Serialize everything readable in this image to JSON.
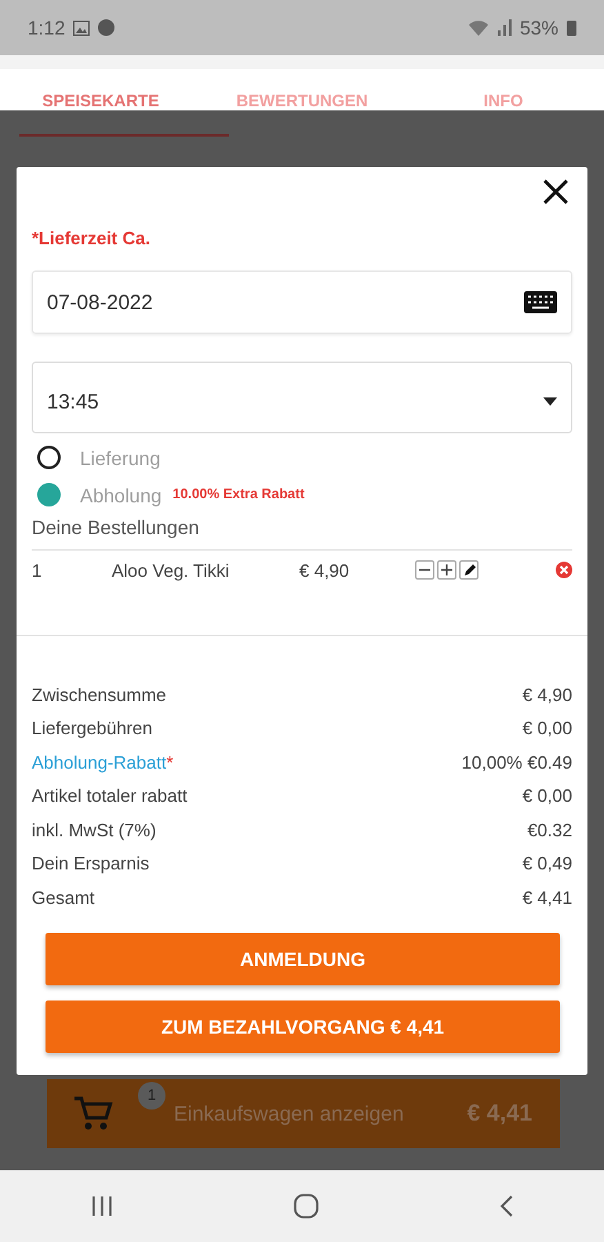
{
  "status_bar": {
    "time": "1:12",
    "battery": "53%"
  },
  "tabs": [
    {
      "label": "SPEISEKARTE",
      "selected": true
    },
    {
      "label": "BEWERTUNGEN",
      "selected": false
    },
    {
      "label": "INFO",
      "selected": false
    }
  ],
  "modal": {
    "title": "*Lieferzeit Ca.",
    "date_field": {
      "value": "07-08-2022"
    },
    "time_select": {
      "value": "13:45"
    },
    "options": [
      {
        "label": "Lieferung",
        "selected": false
      },
      {
        "label": "Abholung",
        "selected": true,
        "note": "10.00% Extra Rabatt"
      }
    ],
    "orders_heading": "Deine Bestellungen",
    "orders": [
      {
        "qty": "1",
        "name": "Aloo Veg. Tikki",
        "price": "€ 4,90"
      }
    ],
    "summary": [
      {
        "label": "Zwischensumme",
        "value": "€ 4,90",
        "kind": "plain"
      },
      {
        "label": "Liefergebühren",
        "value": "€ 0,00",
        "kind": "plain"
      },
      {
        "label": "Abholung-Rabatt",
        "marker": "*",
        "value": "10,00% €0.49",
        "kind": "link"
      },
      {
        "label": "Artikel totaler rabatt",
        "value": "€ 0,00",
        "kind": "plain"
      },
      {
        "label": "inkl. MwSt (7%)",
        "value": "€0.32",
        "kind": "plain"
      },
      {
        "label": "Dein Ersparnis",
        "value": "€ 0,49",
        "kind": "plain"
      },
      {
        "label": "Gesamt",
        "value": "€ 4,41",
        "kind": "plain"
      }
    ],
    "buttons": [
      "ANMELDUNG",
      "ZUM BEZAHLVORGANG € 4,41"
    ]
  },
  "cart_bar": {
    "badge": "1",
    "label": "Einkaufswagen anzeigen",
    "total": "€ 4,41"
  }
}
